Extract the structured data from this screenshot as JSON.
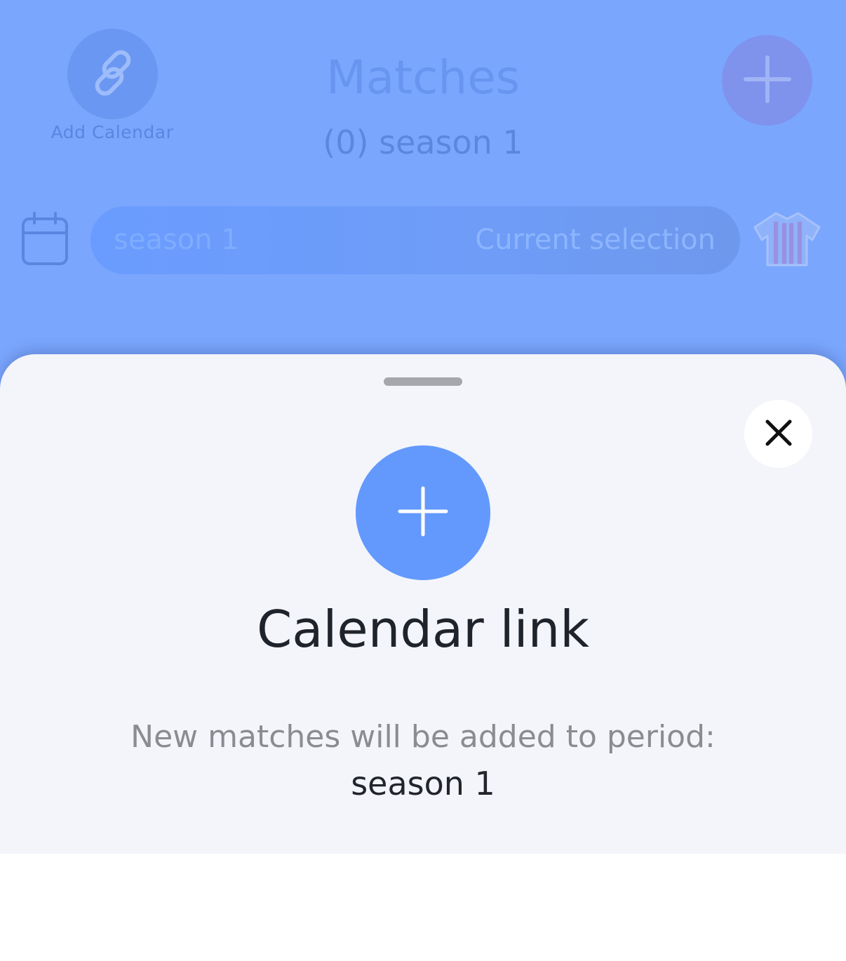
{
  "header": {
    "add_calendar_label": "Add Calendar",
    "title": "Matches",
    "subtitle": "(0) season 1"
  },
  "period_selector": {
    "value": "season 1",
    "hint": "Current selection"
  },
  "sheet": {
    "title": "Calendar link",
    "description": "New matches will be added to period:",
    "period": "season 1"
  },
  "icons": {
    "add_calendar": "link-icon",
    "add_match": "plus-icon",
    "calendar": "calendar-icon",
    "team": "shirt-icon",
    "close": "close-icon",
    "sheet_add": "plus-icon"
  },
  "colors": {
    "accent": "#6399fd",
    "background_overlay": "#7aa6fd",
    "sheet_bg": "#f3f5fa",
    "add_match_button": "#7f92ec"
  }
}
